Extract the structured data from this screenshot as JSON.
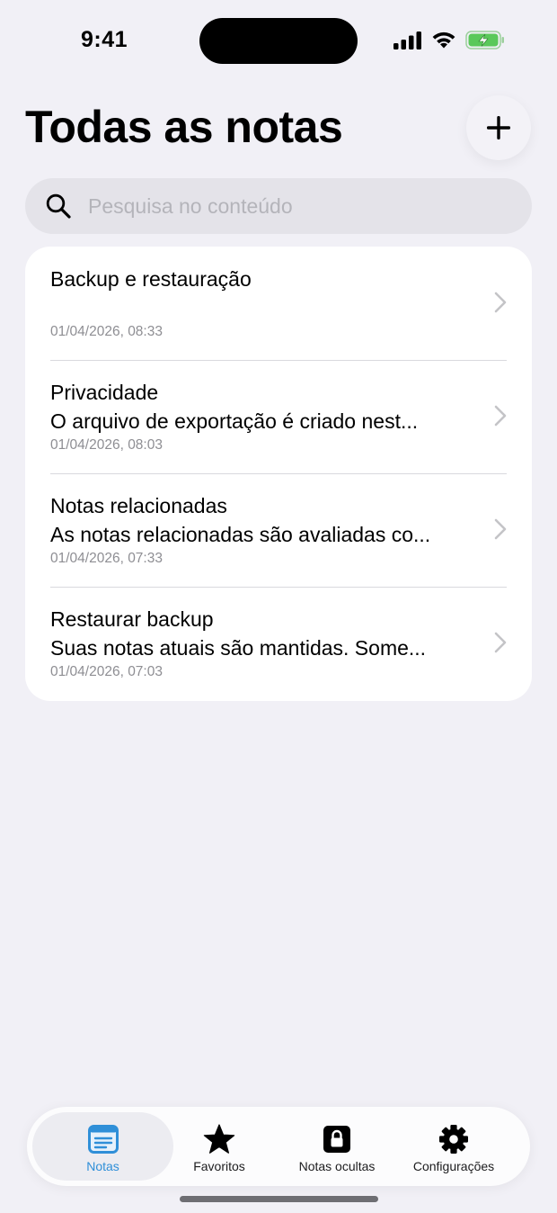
{
  "status_bar": {
    "time": "9:41"
  },
  "header": {
    "title": "Todas as notas",
    "add_icon": "plus-icon"
  },
  "search": {
    "placeholder": "Pesquisa no conteúdo",
    "value": "",
    "icon": "search-icon"
  },
  "notes": [
    {
      "title": "Backup e restauração",
      "preview": "",
      "date": "01/04/2026, 08:33"
    },
    {
      "title": "Privacidade",
      "preview": "O arquivo de exportação é criado nest...",
      "date": "01/04/2026, 08:03"
    },
    {
      "title": "Notas relacionadas",
      "preview": "As notas relacionadas são avaliadas co...",
      "date": "01/04/2026, 07:33"
    },
    {
      "title": "Restaurar backup",
      "preview": "Suas notas atuais são mantidas. Some...",
      "date": "01/04/2026, 07:03"
    }
  ],
  "tabs": [
    {
      "label": "Notas",
      "icon": "note-icon",
      "active": true
    },
    {
      "label": "Favoritos",
      "icon": "star-icon",
      "active": false
    },
    {
      "label": "Notas ocultas",
      "icon": "lock-icon",
      "active": false
    },
    {
      "label": "Configurações",
      "icon": "gear-icon",
      "active": false
    }
  ],
  "colors": {
    "background": "#f1f0f6",
    "accent": "#2f8fd8",
    "battery": "#5ac85a"
  }
}
